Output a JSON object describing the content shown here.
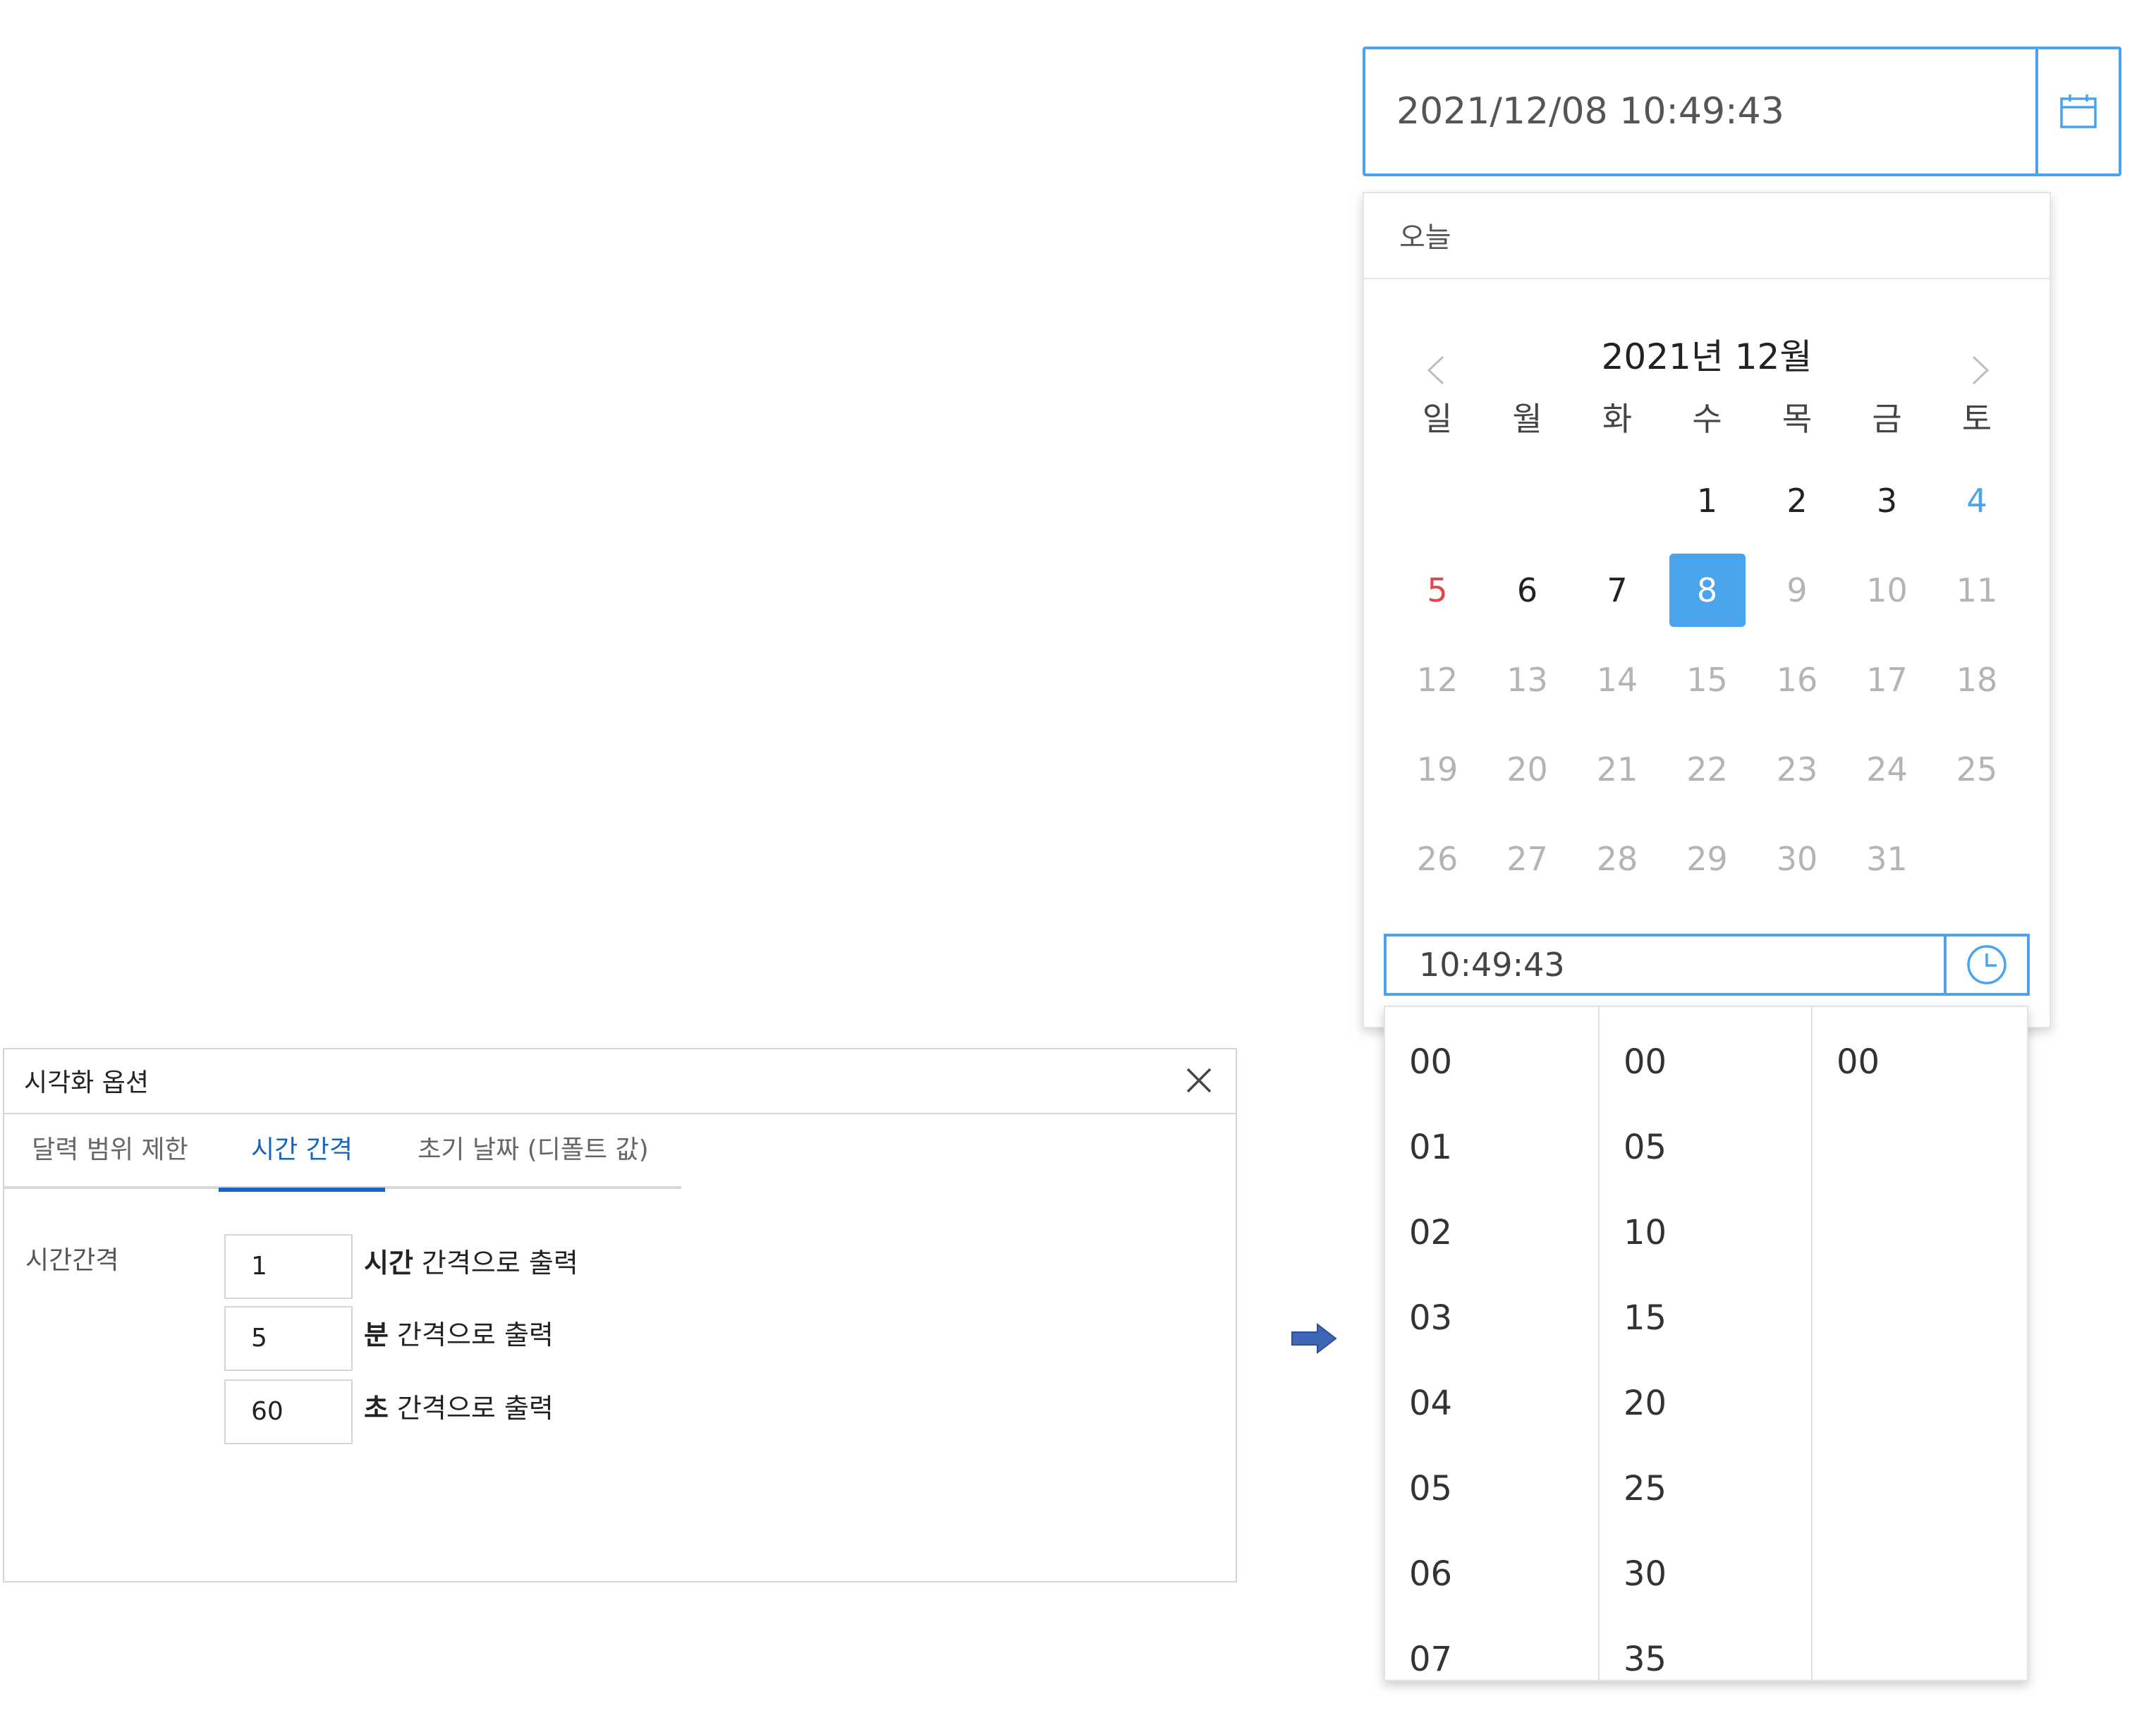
{
  "options_panel": {
    "title": "시각화 옵션",
    "tabs": [
      {
        "label": "달력 범위 제한"
      },
      {
        "label": "시간 간격",
        "active": true
      },
      {
        "label": "초기 날짜 (디폴트 값)"
      }
    ],
    "row_label": "시간간격",
    "rows": [
      {
        "value": "1",
        "bold": "시간",
        "suffix": " 간격으로 출력"
      },
      {
        "value": "5",
        "bold": "분",
        "suffix": " 간격으로 출력"
      },
      {
        "value": "60",
        "bold": "초",
        "suffix": " 간격으로 출력"
      }
    ],
    "close_icon": "close-icon"
  },
  "arrow_icon": "right-arrow-icon",
  "date_picker": {
    "value": "2021/12/08 10:49:43",
    "icon": "calendar-icon",
    "today_label": "오늘",
    "month_label": "2021년 12월",
    "weekdays": [
      "일",
      "월",
      "화",
      "수",
      "목",
      "금",
      "토"
    ],
    "days": [
      "1",
      "2",
      "3",
      "4",
      "5",
      "6",
      "7",
      "8",
      "9",
      "10",
      "11",
      "12",
      "13",
      "14",
      "15",
      "16",
      "17",
      "18",
      "19",
      "20",
      "21",
      "22",
      "23",
      "24",
      "25",
      "26",
      "27",
      "28",
      "29",
      "30",
      "31"
    ],
    "first_weekday_index": 3,
    "selected_day": "8",
    "last_enabled_day": "8",
    "time_value": "10:49:43",
    "time_icon": "clock-icon"
  },
  "time_lists": {
    "hours": [
      "00",
      "01",
      "02",
      "03",
      "04",
      "05",
      "06",
      "07"
    ],
    "minutes": [
      "00",
      "05",
      "10",
      "15",
      "20",
      "25",
      "30",
      "35"
    ],
    "seconds": [
      "00"
    ]
  },
  "colors": {
    "accent": "#4aa3ec",
    "tab_active": "#1565c0",
    "sunday": "#e04848",
    "saturday": "#4aa3ec",
    "disabled": "#b4b4b4",
    "arrow": "#3f67b8"
  }
}
